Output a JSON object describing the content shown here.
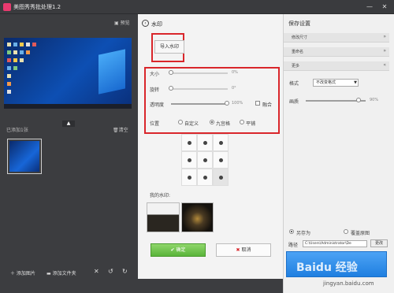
{
  "app": {
    "title": "美图秀秀批处理1.2"
  },
  "window_controls": {
    "minimize": "—",
    "close": "✕"
  },
  "left": {
    "preview_label": "预览",
    "added_count_label": "已添加1张",
    "clear_label": "清空",
    "bottom_actions": {
      "add_image": "添加图片",
      "add_folder": "添加文件夹"
    }
  },
  "watermark": {
    "title": "水印",
    "import_label": "导入水印",
    "size_label": "大小",
    "size_value": "0%",
    "rotate_label": "旋转",
    "rotate_value": "0°",
    "opacity_label": "透明度",
    "opacity_value": "100%",
    "blend_label": "融合",
    "position_label": "位置",
    "position_options": [
      "自定义",
      "九宫格",
      "平铺"
    ],
    "position_selected": "九宫格",
    "my_watermarks_label": "我的水印:",
    "ok_label": "确定",
    "cancel_label": "取消"
  },
  "right": {
    "save_settings_label": "保存设置",
    "sections": [
      {
        "label": "修改尺寸",
        "arrow": "»"
      },
      {
        "label": "重命名",
        "arrow": "»"
      },
      {
        "label": "更多",
        "arrow": "«"
      }
    ],
    "format_label": "格式",
    "format_value": "不改变格式",
    "quality_label": "画质",
    "quality_value": "90%",
    "save_as_label": "另存为",
    "overwrite_label": "覆盖原图",
    "path_label": "路径",
    "path_value": "C:\\Users\\Administrator\\De",
    "change_label": "更改",
    "watermark_overlay": "Baidu 经验",
    "site_url": "jingyan.baidu.com"
  },
  "colors": {
    "accent_red": "#d9262b",
    "ok_green": "#59b43a",
    "save_blue": "#1f7fe0"
  }
}
